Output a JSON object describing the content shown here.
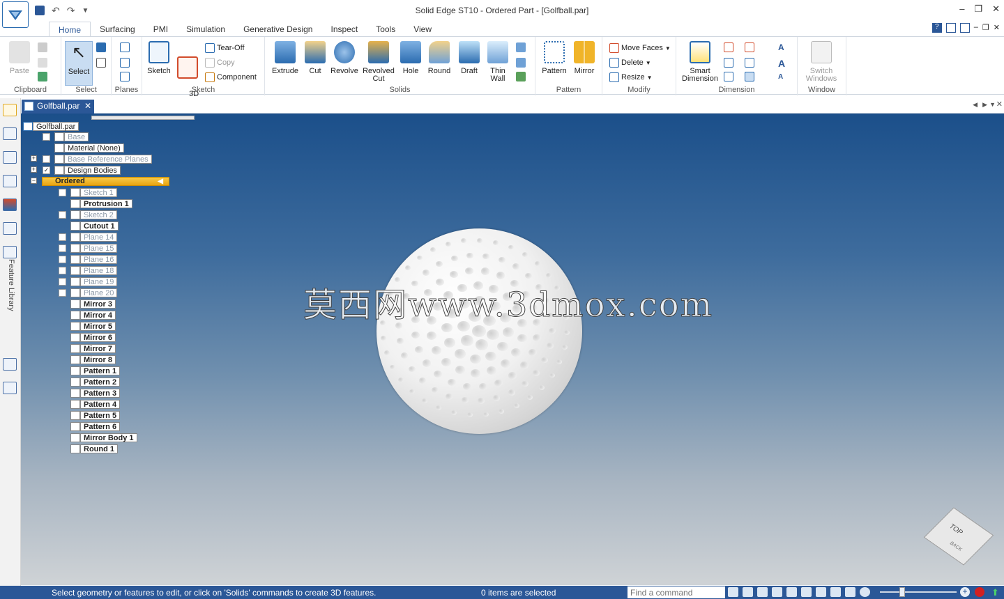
{
  "app": {
    "title": "Solid Edge ST10 - Ordered Part - [Golfball.par]"
  },
  "ribbon_tabs": [
    "Home",
    "Surfacing",
    "PMI",
    "Simulation",
    "Generative Design",
    "Inspect",
    "Tools",
    "View"
  ],
  "groups": {
    "clipboard": {
      "label": "Clipboard",
      "paste": "Paste"
    },
    "select": {
      "label": "Select",
      "select": "Select"
    },
    "planes": {
      "label": "Planes"
    },
    "sketch": {
      "label": "Sketch",
      "sketch": "Sketch",
      "sketch3d": "3D\nSketch",
      "tearoff": "Tear-Off",
      "copy": "Copy",
      "component": "Component"
    },
    "solids": {
      "label": "Solids",
      "extrude": "Extrude",
      "cut": "Cut",
      "revolve": "Revolve",
      "revolved_cut": "Revolved\nCut",
      "hole": "Hole",
      "round": "Round",
      "draft": "Draft",
      "thin_wall": "Thin\nWall"
    },
    "pattern": {
      "label": "Pattern",
      "pattern": "Pattern",
      "mirror": "Mirror"
    },
    "modify": {
      "label": "Modify",
      "move_faces": "Move Faces",
      "delete": "Delete",
      "resize": "Resize"
    },
    "dimension": {
      "label": "Dimension",
      "smart_dimension": "Smart\nDimension"
    },
    "window": {
      "label": "Window",
      "switch_windows": "Switch\nWindows"
    }
  },
  "document_tab": "Golfball.par",
  "left_rail": {
    "feature_library": "Feature Library"
  },
  "tree": {
    "root": "Golfball.par",
    "base": "Base",
    "material": "Material (None)",
    "base_ref_planes": "Base Reference Planes",
    "design_bodies": "Design Bodies",
    "ordered": "Ordered",
    "features": [
      {
        "label": "Sketch 1",
        "style": "dim",
        "check": true
      },
      {
        "label": "Protrusion 1",
        "style": "bold",
        "check": false
      },
      {
        "label": "Sketch 2",
        "style": "dim",
        "check": true
      },
      {
        "label": "Cutout 1",
        "style": "bold",
        "check": false
      },
      {
        "label": "Plane 14",
        "style": "dim",
        "check": true
      },
      {
        "label": "Plane 15",
        "style": "dim",
        "check": true
      },
      {
        "label": "Plane 16",
        "style": "dim",
        "check": true
      },
      {
        "label": "Plane 18",
        "style": "dim",
        "check": true
      },
      {
        "label": "Plane 19",
        "style": "dim",
        "check": true
      },
      {
        "label": "Plane 20",
        "style": "dim",
        "check": true
      },
      {
        "label": "Mirror 3",
        "style": "bold",
        "check": false
      },
      {
        "label": "Mirror 4",
        "style": "bold",
        "check": false
      },
      {
        "label": "Mirror 5",
        "style": "bold",
        "check": false
      },
      {
        "label": "Mirror 6",
        "style": "bold",
        "check": false
      },
      {
        "label": "Mirror 7",
        "style": "bold",
        "check": false
      },
      {
        "label": "Mirror 8",
        "style": "bold",
        "check": false
      },
      {
        "label": "Pattern 1",
        "style": "bold",
        "check": false
      },
      {
        "label": "Pattern 2",
        "style": "bold",
        "check": false
      },
      {
        "label": "Pattern 3",
        "style": "bold",
        "check": false
      },
      {
        "label": "Pattern 4",
        "style": "bold",
        "check": false
      },
      {
        "label": "Pattern 5",
        "style": "bold",
        "check": false
      },
      {
        "label": "Pattern 6",
        "style": "bold",
        "check": false
      },
      {
        "label": "Mirror Body 1",
        "style": "bold",
        "check": false
      },
      {
        "label": "Round 1",
        "style": "bold",
        "check": false
      }
    ]
  },
  "watermark": "莫西网www.3dmox.com",
  "view_cube": {
    "top": "TOP",
    "back": "BACK"
  },
  "status": {
    "message": "Select geometry or features to edit, or click on 'Solids' commands to create 3D features.",
    "selection": "0 items are selected",
    "command_placeholder": "Find a command"
  },
  "colors": {
    "accent": "#2b5797",
    "ordered_highlight": "#f1b52c"
  }
}
